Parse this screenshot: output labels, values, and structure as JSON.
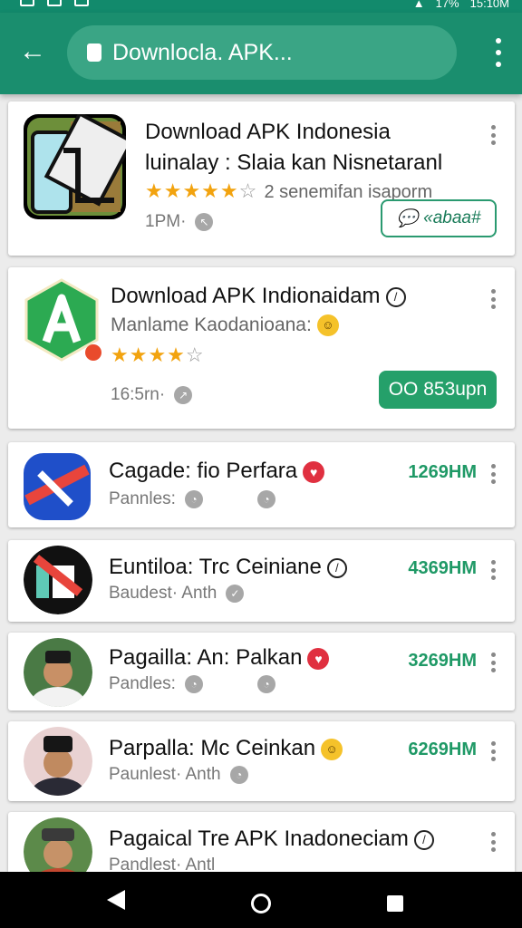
{
  "status_bar": {
    "battery": "17%",
    "time": "15:10M"
  },
  "toolbar": {
    "url": "Downlocla. APK..."
  },
  "apps": [
    {
      "title_line1": "Download APK Indonesia",
      "title_line2": "luinalay : Slaia kan Nisnetaranl",
      "rating_text": "2 senemifan isaporm",
      "meta": "1PM·",
      "button_label": "«abaa#",
      "stars_filled": 5,
      "stars_empty": 1
    },
    {
      "title": "Download APK Indionaidam",
      "subtitle": "Manlame  Kaodanioana:",
      "meta": "16:5rn·",
      "button_label": "OO 853upn",
      "stars_filled": 4,
      "stars_empty": 1
    },
    {
      "title": "Cagade: fio Perfara",
      "subtitle": "Pannles:",
      "size": "1269HM"
    },
    {
      "title": "Euntiloa: Trc Ceiniane",
      "subtitle": "Baudest·  Anth",
      "size": "4369HM"
    },
    {
      "title": "Pagailla: An: Palkan",
      "subtitle": "Pandles:",
      "size": "3269HM"
    },
    {
      "title": "Parpalla: Mc Ceinkan",
      "subtitle": "Paunlest·  Anth",
      "size": "6269HM"
    },
    {
      "title": "Pagaical Tre APK Inadoneciam",
      "subtitle": "Pandlest·  Antl"
    }
  ],
  "colors": {
    "primary": "#1a8e6e",
    "accent": "#25a06a",
    "star": "#f2a30f",
    "background": "#ececec"
  },
  "icons": [
    "back-arrow-icon",
    "lock-icon",
    "overflow-menu-icon",
    "star-icon",
    "chat-icon",
    "heart-icon",
    "clock-icon",
    "nav-back-icon",
    "nav-home-icon",
    "nav-recent-icon"
  ]
}
